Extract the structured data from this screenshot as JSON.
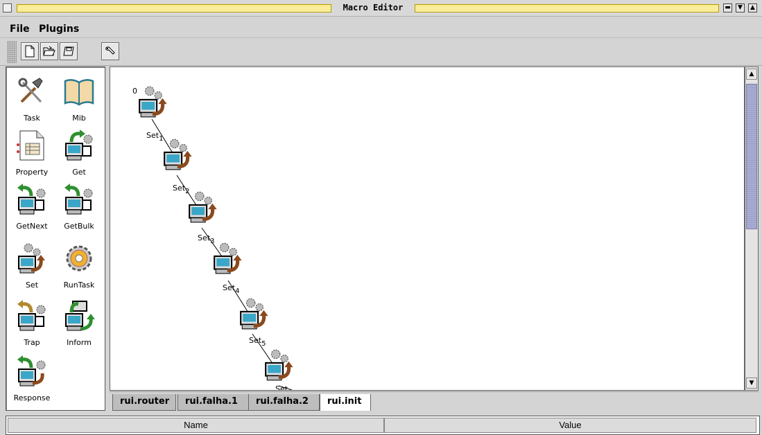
{
  "window": {
    "title": "Macro Editor"
  },
  "menu": {
    "file": "File",
    "plugins": "Plugins"
  },
  "toolbar": {
    "buttons": [
      {
        "name": "new",
        "icon": "new-document-icon"
      },
      {
        "name": "open",
        "icon": "open-folder-icon"
      },
      {
        "name": "save",
        "icon": "save-disk-icon"
      },
      {
        "name": "run",
        "icon": "wrench-icon"
      }
    ]
  },
  "palette": {
    "items": [
      {
        "label": "Task",
        "icon": "tools-icon"
      },
      {
        "label": "Mib",
        "icon": "book-icon"
      },
      {
        "label": "Property",
        "icon": "property-sheet-icon"
      },
      {
        "label": "Get",
        "icon": "get-icon"
      },
      {
        "label": "GetNext",
        "icon": "getnext-icon"
      },
      {
        "label": "GetBulk",
        "icon": "getbulk-icon"
      },
      {
        "label": "Set",
        "icon": "set-icon"
      },
      {
        "label": "RunTask",
        "icon": "runtask-gear-icon"
      },
      {
        "label": "Trap",
        "icon": "trap-icon"
      },
      {
        "label": "Inform",
        "icon": "inform-icon"
      },
      {
        "label": "Response",
        "icon": "response-icon"
      }
    ]
  },
  "diagram": {
    "nodes": [
      {
        "index": "0",
        "label": ""
      },
      {
        "index": "1",
        "label": "Set"
      },
      {
        "index": "2",
        "label": "Set"
      },
      {
        "index": "3",
        "label": "Set"
      },
      {
        "index": "4",
        "label": "Set"
      },
      {
        "index": "5",
        "label": "Set"
      }
    ],
    "partial_label": "Set"
  },
  "tabs": [
    {
      "label": "rui.router",
      "active": false
    },
    {
      "label": "rui.falha.1",
      "active": false
    },
    {
      "label": "rui.falha.2",
      "active": false
    },
    {
      "label": "rui.init",
      "active": true
    }
  ],
  "properties": {
    "columns": [
      "Name",
      "Value"
    ]
  },
  "colors": {
    "title_stripe": "#f5e36a",
    "scroll_thumb": "#b6b9da"
  }
}
